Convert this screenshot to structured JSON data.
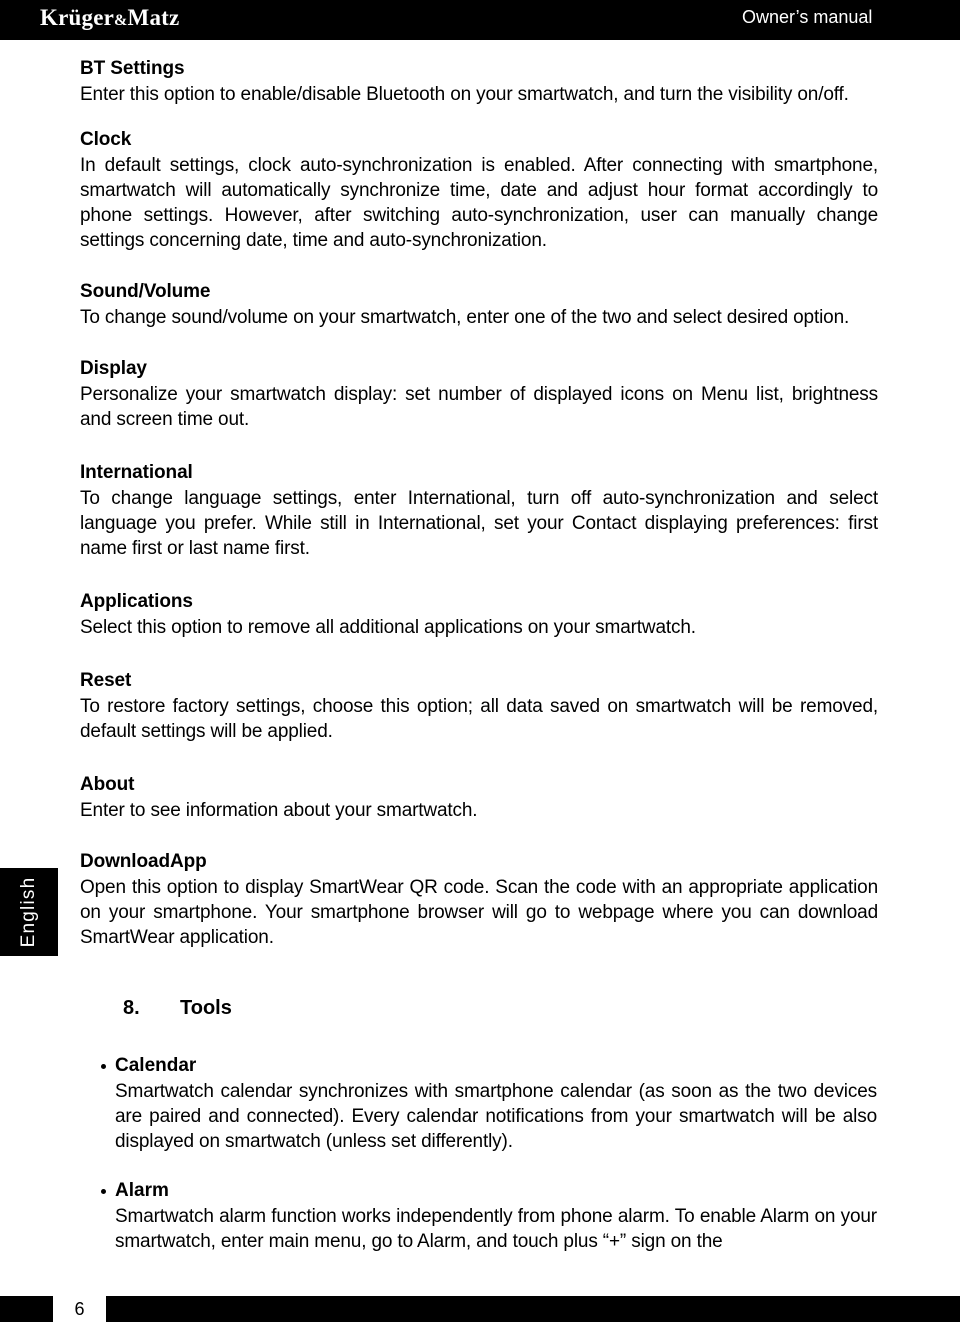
{
  "header": {
    "brand_prefix": "Krüger",
    "brand_amp": "&",
    "brand_suffix": "Matz",
    "right_label": "Owner’s manual"
  },
  "side_tab": {
    "label": "English"
  },
  "sections": [
    {
      "title": "BT Settings",
      "body": "Enter this option to enable/disable Bluetooth on your smartwatch, and turn the visibility on/off."
    },
    {
      "title": "Clock",
      "body": "In default settings, clock auto-synchronization is enabled. After connecting with smartphone, smartwatch will automatically synchronize time, date and adjust hour format accordingly to phone settings. However, after switching auto-synchronization, user can manually change settings concerning date, time and auto-synchronization."
    },
    {
      "title": "Sound/Volume",
      "body": "To change sound/volume on your smartwatch, enter one of the two and select desired option."
    },
    {
      "title": "Display",
      "body": "Personalize your smartwatch display: set number of displayed icons on Menu list, brightness and screen time out."
    },
    {
      "title": "International",
      "body": "To change language settings, enter International, turn off auto-synchronization and select language you prefer. While still in International, set your Contact displaying preferences: first name first or last name first."
    },
    {
      "title": "Applications",
      "body": "Select this option to remove all additional applications on your smartwatch."
    },
    {
      "title": "Reset",
      "body": "To restore factory settings, choose this option; all data saved on smartwatch will be removed, default settings will be applied."
    },
    {
      "title": "About",
      "body": "Enter to see information about your smartwatch."
    },
    {
      "title": "DownloadApp",
      "body": "Open this option to display SmartWear QR code. Scan the code with an appropriate application on your smartphone. Your smartphone browser will go to webpage where you can download SmartWear application."
    }
  ],
  "chapter": {
    "number": "8.",
    "title": "Tools",
    "items": [
      {
        "title": "Calendar",
        "body": "Smartwatch calendar synchronizes with smartphone calendar (as soon as the two devices are paired and connected). Every calendar notifications from your smartwatch will be also displayed on smartwatch (unless set differently)."
      },
      {
        "title": "Alarm",
        "body": "Smartwatch alarm function works independently from phone alarm. To enable Alarm on your smartwatch, enter main menu, go to Alarm, and touch plus “+” sign on the"
      }
    ]
  },
  "footer": {
    "page_number": "6"
  }
}
